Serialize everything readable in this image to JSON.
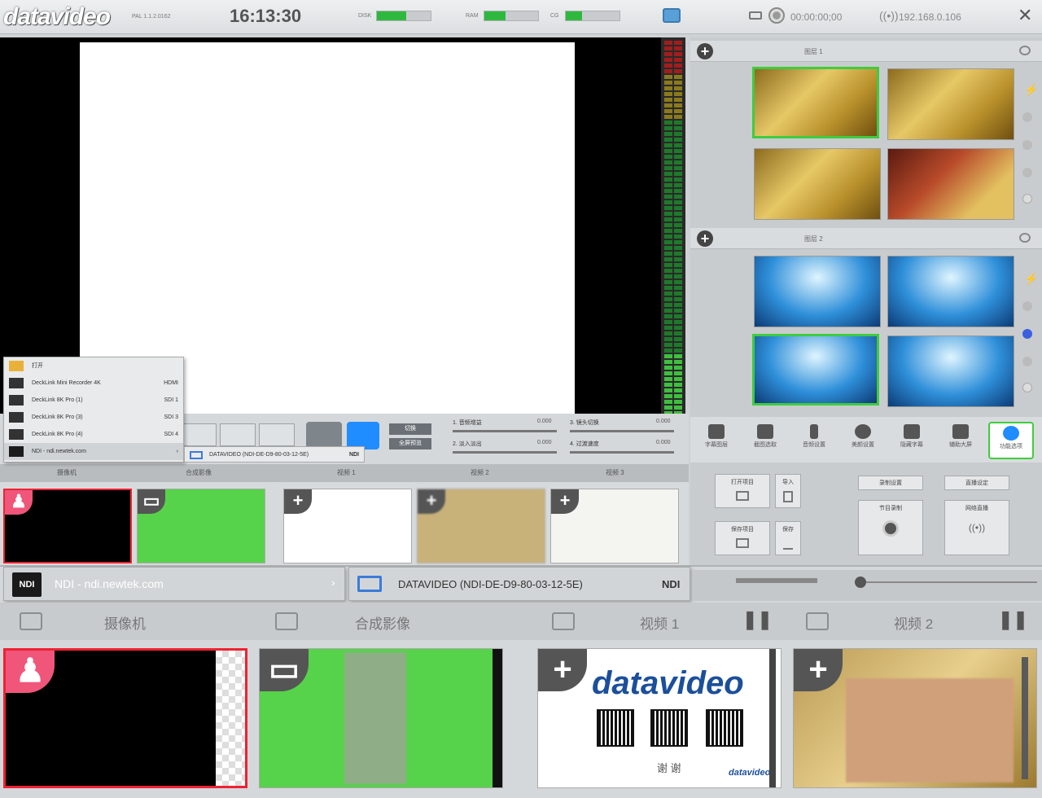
{
  "topbar": {
    "logo": "datavideo",
    "version": "PAL 1.1.2.0162",
    "clock": "16:13:30",
    "disk_label": "DISK",
    "ram_label": "RAM",
    "cg_label": "CG",
    "disk_level": 0.55,
    "ram_level": 0.4,
    "cg_level": 0.3,
    "timecode": "00:00:00;00",
    "ip": "192.168.0.106",
    "close": "✕"
  },
  "sliders": [
    {
      "label": "1. 音频增益",
      "value": "0.000"
    },
    {
      "label": "2. 淡入淡出",
      "value": "0.000"
    },
    {
      "label": "3. 镜头切换",
      "value": "0.000"
    },
    {
      "label": "4. 过渡速度",
      "value": "0.000"
    }
  ],
  "ctrl_buttons": {
    "take": "切换",
    "auto": "全屏预览"
  },
  "context_menu": {
    "open": "打开",
    "items": [
      {
        "label": "DeckLink Mini Recorder 4K",
        "tag": "HDMI"
      },
      {
        "label": "DeckLink 8K Pro (1)",
        "tag": "SDI 1"
      },
      {
        "label": "DeckLink 8K Pro (3)",
        "tag": "SDI 3"
      },
      {
        "label": "DeckLink 8K Pro (4)",
        "tag": "SDI 4"
      },
      {
        "label": "NDI - ndi.newtek.com",
        "tag": "›"
      }
    ],
    "sub_item": {
      "label": "DATAVIDEO (NDI-DE-D9-80-03-12-5E)",
      "tag": "NDI"
    }
  },
  "right_panel": {
    "group1_title": "图层 1",
    "group2_title": "图层 2",
    "icons": [
      {
        "label": "字幕图层",
        "icon": "layers-icon"
      },
      {
        "label": "截图选取",
        "icon": "camera-icon"
      },
      {
        "label": "音频设置",
        "icon": "mic-icon"
      },
      {
        "label": "美颜设置",
        "icon": "face-icon"
      },
      {
        "label": "隐藏字幕",
        "icon": "cc-icon"
      },
      {
        "label": "辅助大屏",
        "icon": "monitor-icon"
      },
      {
        "label": "功能选项",
        "icon": "gear-icon"
      }
    ],
    "file_open": "打开项目",
    "file_import": "导入",
    "file_save": "保存项目",
    "file_save2": "保存",
    "record_label": "录制设置",
    "record_btn": "节目录制",
    "stream_label": "直播设定",
    "stream_btn": "网络直播"
  },
  "source_tabs": [
    "摄像机",
    "合成影像",
    "视频 1",
    "视频 2",
    "视频 3"
  ],
  "zoom": {
    "ndi_source": "NDI - ndi.newtek.com",
    "ndi_device": "DATAVIDEO (NDI-DE-D9-80-03-12-5E)",
    "ndi_tag": "NDI",
    "arrow": "›",
    "tabs": [
      "摄像机",
      "合成影像",
      "视频 1",
      "视频 2"
    ],
    "card_brand": "datavideo",
    "card_thanks": "谢 谢",
    "card_footer": "datavideo"
  },
  "colors": {
    "accent_green": "#3fcc3f",
    "accent_blue": "#1f8cff",
    "live_red": "#ee2233"
  }
}
